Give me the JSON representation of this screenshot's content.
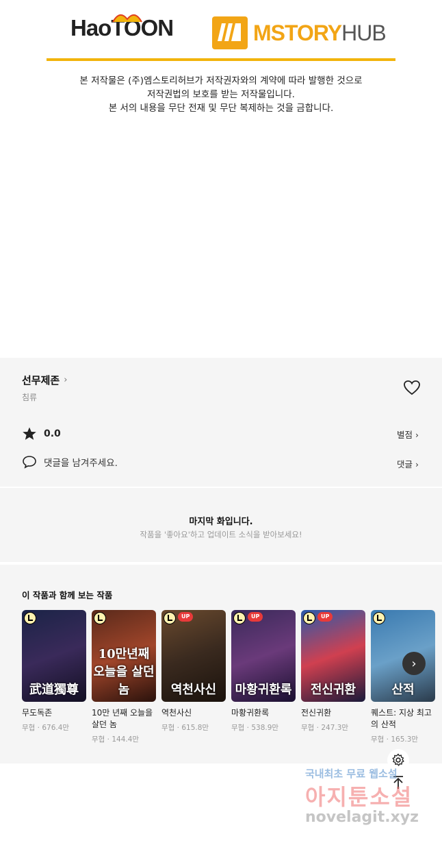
{
  "header": {
    "brand_left": "HaoTOON",
    "brand_right_main": "MSTORY",
    "brand_right_sub": "HUB",
    "notice_lines": [
      "본 저작물은 (주)엠스토리허브가 저작권자와의 계약에 따라 발행한 것으로",
      "저작권법의 보호를 받는 저작물입니다.",
      "본 서의 내용을 무단 전재 및 무단 복제하는 것을 금합니다."
    ],
    "accent_color": "#f2b40c"
  },
  "work": {
    "title": "선무제존",
    "title_chevron": "›",
    "genre": "침류",
    "rating_value": "0.0",
    "rate_label": "별점",
    "comment_placeholder": "댓글을 남겨주세요.",
    "comment_label": "댓글",
    "link_chevron": "›"
  },
  "last_episode": {
    "heading": "마지막 화입니다.",
    "subtext": "작품을 '좋아요'하고 업데이트 소식을 받아보세요!"
  },
  "recommendations": {
    "header": "이 작품과 함께 보는 작품",
    "items": [
      {
        "name": "무도독존",
        "genre": "무협",
        "views": "676.4만",
        "caption": "武道獨尊",
        "badge_up": false,
        "bg": "linear-gradient(160deg,#1b2447,#3a2a5a 50%,#120f22)"
      },
      {
        "name": "10만 년째 오늘을 살던 놈",
        "genre": "무협",
        "views": "144.4만",
        "caption": "10만년째 오늘을 살던놈",
        "badge_up": false,
        "bg": "linear-gradient(160deg,#5a2a1b,#a0452a 50%,#2a120c)"
      },
      {
        "name": "역천사신",
        "genre": "무협",
        "views": "615.8만",
        "caption": "역천사신",
        "badge_up": true,
        "bg": "linear-gradient(160deg,#6a4a2e,#3a2a1f 50%,#1a120c)"
      },
      {
        "name": "마황귀환록",
        "genre": "무협",
        "views": "538.9만",
        "caption": "마황귀환록",
        "badge_up": true,
        "bg": "linear-gradient(160deg,#3a2a5a,#6a3a7a 50%,#1a1030)"
      },
      {
        "name": "전신귀환",
        "genre": "무협",
        "views": "247.3만",
        "caption": "전신귀환",
        "badge_up": true,
        "bg": "linear-gradient(160deg,#2a5aaa,#d04050 50%,#1a1a3a)"
      },
      {
        "name": "퀘스트: 지상 최고의 산적",
        "genre": "무협",
        "views": "165.3만",
        "caption": "산적",
        "badge_up": false,
        "bg": "linear-gradient(160deg,#3a7ab0,#6aa0c8 50%,#2a3a4a)"
      }
    ],
    "separator": "·"
  },
  "floating": {
    "settings_icon": "gear-icon",
    "top_icon": "arrow-up-icon"
  },
  "watermark": {
    "line1": "국내최초 무료 웹소설",
    "line2": "아지툰소설",
    "line3": "novelagit.xyz"
  }
}
